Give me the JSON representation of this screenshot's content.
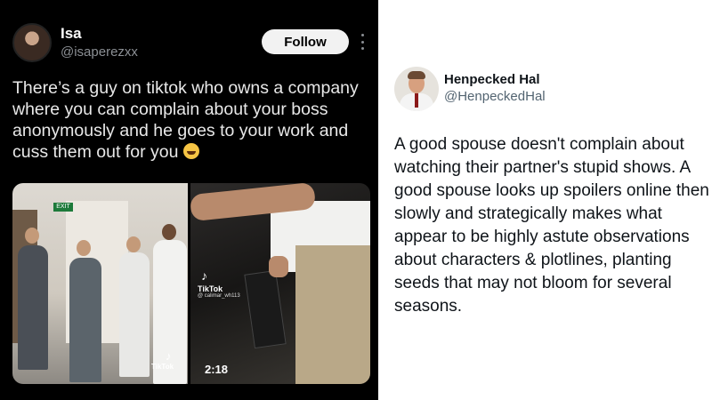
{
  "left_tweet": {
    "name": "Isa",
    "handle": "@isaperezxx",
    "follow_label": "Follow",
    "text": "There’s a guy on tiktok who owns a company where you can complain about your boss anonymously and he goes to your work and cuss them out for you",
    "emoji_icon": "tears-of-joy-icon",
    "media": {
      "exit_sign": "EXIT",
      "tiktok_label_left": "TikTok",
      "tiktok_label_right": "TikTok",
      "tiktok_user_right": "@ calimar_wh113",
      "duration": "2:18"
    }
  },
  "right_tweet": {
    "name": "Henpecked Hal",
    "handle": "@HenpeckedHal",
    "text": "A good spouse doesn't complain about watching their partner's stupid shows. A good spouse looks up spoilers online then slowly and strategically makes what appear to be highly astute observations about characters & plotlines, planting seeds that may not bloom for several seasons."
  },
  "colors": {
    "dark_bg": "#000000",
    "light_bg": "#ffffff",
    "muted_text": "#8b8f94",
    "handle_gray": "#536471"
  }
}
